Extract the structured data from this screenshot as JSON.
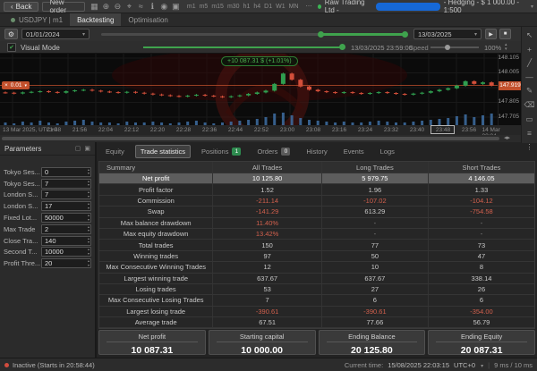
{
  "topbar": {
    "back_label": "Back",
    "new_order_label": "New order",
    "icons": [
      {
        "name": "chart-layout-icon",
        "glyph": "▦"
      },
      {
        "name": "zoom-in-icon",
        "glyph": "⊕"
      },
      {
        "name": "zoom-out-icon",
        "glyph": "⊖"
      },
      {
        "name": "crosshair-icon",
        "glyph": "⌖"
      },
      {
        "name": "indicators-icon",
        "glyph": "≈"
      },
      {
        "name": "info-icon",
        "glyph": "ℹ"
      },
      {
        "name": "watchlist-icon",
        "glyph": "◉"
      },
      {
        "name": "snapshot-icon",
        "glyph": "▣"
      }
    ],
    "timeframes": [
      "m1",
      "m5",
      "m15",
      "m30",
      "h1",
      "h4",
      "D1",
      "W1",
      "MN"
    ],
    "overflow_icon": "⋯",
    "account": {
      "broker": "Raw Trading Ltd -",
      "details": "- Hedging - $ 1 000.00 - 1:500",
      "status_color": "#3cb454",
      "redaction_color": "#1668d6"
    }
  },
  "tabs": {
    "instrument": "USDJPY | m1",
    "backtesting": "Backtesting",
    "optimisation": "Optimisation"
  },
  "controls": {
    "start_date": "01/01/2024",
    "end_date": "13/03/2025",
    "play_icon": "▶",
    "stop_icon": "■",
    "save_icon": "▤",
    "visual_mode_label": "Visual Mode",
    "progress_time": "13/03/2025 23:59:00",
    "speed_label": "Speed",
    "speed_value": "100%"
  },
  "right_toolbar": {
    "icons": [
      {
        "name": "cursor-icon",
        "glyph": "↖"
      },
      {
        "name": "crosshair-tool-icon",
        "glyph": "+"
      },
      {
        "name": "trendline-icon",
        "glyph": "╱"
      },
      {
        "name": "horizontal-ray-icon",
        "glyph": "—"
      },
      {
        "name": "pencil-icon",
        "glyph": "✎"
      },
      {
        "name": "eraser-icon",
        "glyph": "⌫"
      },
      {
        "name": "shapes-icon",
        "glyph": "▭"
      },
      {
        "name": "objects-list-icon",
        "glyph": "≡"
      },
      {
        "name": "more-icon",
        "glyph": "⋮"
      }
    ]
  },
  "chart": {
    "tooltip": "+10 087.31 $ (+1.01%)",
    "position_volume": "0.01",
    "close_icon": "×",
    "current_price": "147.919",
    "current_price_value": 147.919,
    "price_ticks": [
      {
        "label": "148.105",
        "price": 148.105
      },
      {
        "label": "148.005",
        "price": 148.005
      },
      {
        "label": "147.805",
        "price": 147.805
      },
      {
        "label": "147.705",
        "price": 147.705
      }
    ],
    "date_label": "13 Mar 2025, UTC+0",
    "time_ticks": [
      "21:48",
      "21:56",
      "22:04",
      "22:12",
      "22:20",
      "22:28",
      "22:36",
      "22:44",
      "22:52",
      "23:00",
      "23:08",
      "23:16",
      "23:24",
      "23:32",
      "23:40",
      "23:48",
      "23:56",
      "14 Mar 00:04"
    ],
    "up_color": "#2f9e4f",
    "down_color": "#d34f3a",
    "volume_color": "#3e6fa3",
    "line_color": "#c2502c",
    "closes": [
      147.87,
      147.865,
      147.872,
      147.876,
      147.88,
      147.875,
      147.87,
      147.88,
      147.886,
      147.89,
      147.884,
      147.878,
      147.874,
      147.87,
      147.876,
      147.87,
      147.864,
      147.858,
      147.853,
      147.848,
      147.844,
      147.85,
      147.856,
      147.85,
      147.845,
      147.84,
      147.846,
      147.852,
      147.862,
      147.872,
      147.884,
      147.93,
      148.0,
      147.958,
      147.912,
      147.89,
      147.88,
      147.874,
      147.868,
      147.874,
      147.868,
      147.862,
      147.868,
      147.874,
      147.868,
      147.862,
      147.857,
      147.864,
      147.87,
      147.88,
      147.89,
      147.9,
      147.918,
      147.948,
      147.93,
      147.94,
      147.919
    ],
    "volumes": [
      3,
      2,
      4,
      3,
      5,
      3,
      2,
      4,
      5,
      6,
      4,
      3,
      3,
      2,
      4,
      3,
      3,
      4,
      3,
      2,
      3,
      4,
      5,
      3,
      2,
      3,
      4,
      5,
      6,
      7,
      9,
      13,
      14,
      11,
      8,
      6,
      5,
      4,
      3,
      4,
      3,
      3,
      4,
      5,
      4,
      3,
      3,
      4,
      5,
      6,
      7,
      8,
      10,
      12,
      9,
      11,
      13
    ]
  },
  "parameters": {
    "title": "Parameters",
    "header_icons": [
      {
        "name": "popout-icon",
        "glyph": "▢"
      },
      {
        "name": "panel-icon",
        "glyph": "▣"
      }
    ],
    "items": [
      {
        "label": "Tokyo Ses...",
        "value": "0"
      },
      {
        "label": "Tokyo Ses...",
        "value": "7"
      },
      {
        "label": "London S...",
        "value": "7"
      },
      {
        "label": "London S...",
        "value": "17"
      },
      {
        "label": "Fixed Lot...",
        "value": "50000"
      },
      {
        "label": "Max Trade",
        "value": "2"
      },
      {
        "label": "Close Tra...",
        "value": "140"
      },
      {
        "label": "Second T...",
        "value": "10000"
      },
      {
        "label": "Profit Thre...",
        "value": "20"
      }
    ]
  },
  "bottom_tabs": {
    "items": [
      {
        "label": "Equity"
      },
      {
        "label": "Trade statistics",
        "active": true
      },
      {
        "label": "Positions",
        "badge": "1",
        "badge_color": "#2e8b4f"
      },
      {
        "label": "Orders",
        "badge": "0",
        "badge_color": "#5a5a5a"
      },
      {
        "label": "History"
      },
      {
        "label": "Events"
      },
      {
        "label": "Logs"
      }
    ]
  },
  "stats_table": {
    "headers": [
      "Summary",
      "All Trades",
      "Long Trades",
      "Short Trades"
    ],
    "rows": [
      {
        "label": "Net profit",
        "values": [
          "10 125.80",
          "5 979.75",
          "4 146.05"
        ],
        "highlight": true
      },
      {
        "label": "Profit factor",
        "values": [
          "1.52",
          "1.96",
          "1.33"
        ]
      },
      {
        "label": "Commission",
        "values": [
          "-211.14",
          "-107.02",
          "-104.12"
        ]
      },
      {
        "label": "Swap",
        "values": [
          "-141.29",
          "613.29",
          "-754.58"
        ]
      },
      {
        "label": "Max balance drawdown",
        "values": [
          "11.40%",
          "-",
          "-"
        ]
      },
      {
        "label": "Max equity drawdown",
        "values": [
          "13.42%",
          "-",
          "-"
        ]
      },
      {
        "label": "Total trades",
        "values": [
          "150",
          "77",
          "73"
        ]
      },
      {
        "label": "Winning trades",
        "values": [
          "97",
          "50",
          "47"
        ]
      },
      {
        "label": "Max Consecutive Winning Trades",
        "values": [
          "12",
          "10",
          "8"
        ]
      },
      {
        "label": "Largest winning trade",
        "values": [
          "637.67",
          "637.67",
          "338.14"
        ]
      },
      {
        "label": "Losing trades",
        "values": [
          "53",
          "27",
          "26"
        ]
      },
      {
        "label": "Max Consecutive Losing Trades",
        "values": [
          "7",
          "6",
          "6"
        ]
      },
      {
        "label": "Largest losing trade",
        "values": [
          "-390.61",
          "-390.61",
          "-354.00"
        ]
      },
      {
        "label": "Average trade",
        "values": [
          "67.51",
          "77.66",
          "56.79"
        ]
      }
    ]
  },
  "summary_cards": [
    {
      "label": "Net profit",
      "value": "10 087.31"
    },
    {
      "label": "Starting capital",
      "value": "10 000.00"
    },
    {
      "label": "Ending Balance",
      "value": "20 125.80"
    },
    {
      "label": "Ending Equity",
      "value": "20 087.31"
    }
  ],
  "statusbar": {
    "left_status": "Inactive (Starts in 20:58:44)",
    "current_time_label": "Current time:",
    "current_time": "15/08/2025 22:03:15",
    "timezone": "UTC+0",
    "latency": "9 ms / 10 ms"
  }
}
